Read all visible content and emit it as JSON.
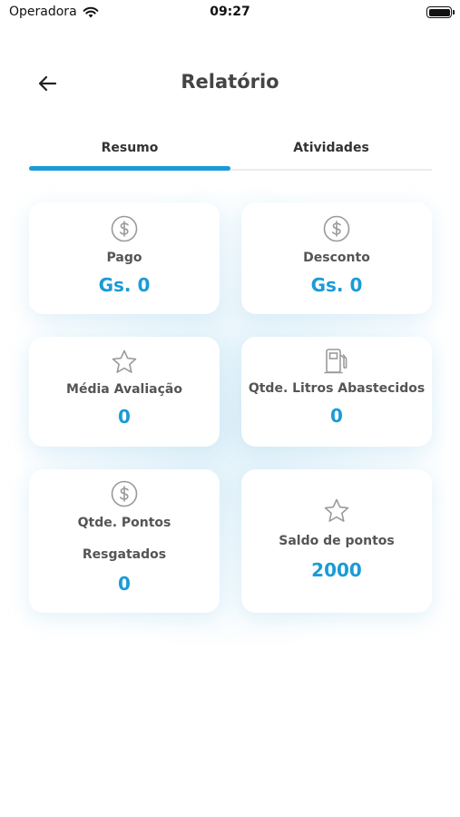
{
  "status_bar": {
    "carrier": "Operadora",
    "time": "09:27"
  },
  "header": {
    "title": "Relatório"
  },
  "tabs": [
    {
      "label": "Resumo",
      "active": true
    },
    {
      "label": "Atividades",
      "active": false
    }
  ],
  "cards": {
    "pago": {
      "icon": "dollar-circle-icon",
      "label": "Pago",
      "value": "Gs. 0"
    },
    "desconto": {
      "icon": "dollar-circle-icon",
      "label": "Desconto",
      "value": "Gs. 0"
    },
    "media_avaliacao": {
      "icon": "star-icon",
      "label": "Média Avaliação",
      "value": "0"
    },
    "litros": {
      "icon": "fuel-pump-icon",
      "label": "Qtde. Litros Abastecidos",
      "value": "0"
    },
    "pontos_resgatados": {
      "icon": "dollar-circle-icon",
      "label_line1": "Qtde. Pontos",
      "label_line2": "Resgatados",
      "value": "0"
    },
    "saldo_pontos": {
      "icon": "star-icon",
      "label": "Saldo de pontos",
      "value": "2000"
    }
  },
  "colors": {
    "accent": "#1a9bd7",
    "icon_gray": "#9a9a9a"
  }
}
